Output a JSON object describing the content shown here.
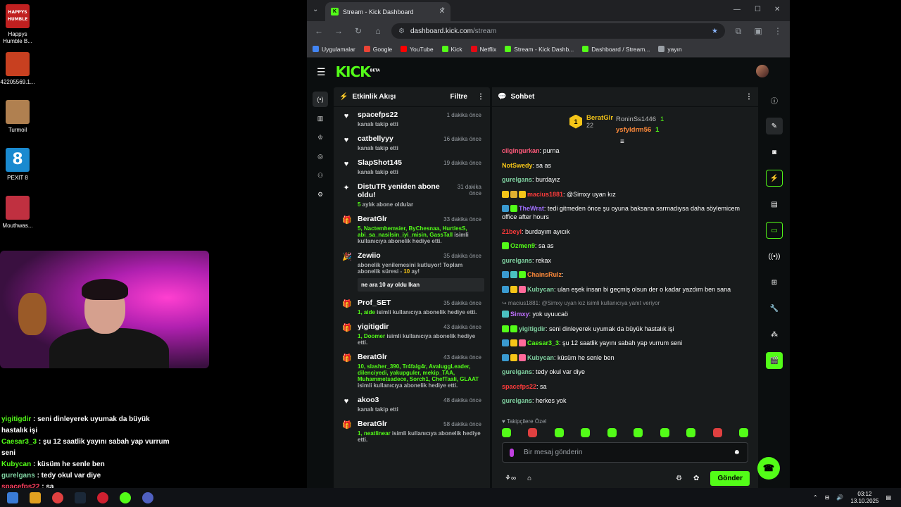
{
  "desktop": {
    "icons": [
      {
        "label": "Happys Humble B...",
        "logo_text": "HAPPYS HUMBLE",
        "color": "#c02020"
      },
      {
        "label": "42205569.1...",
        "logo_text": "",
        "color": "#c84020"
      },
      {
        "label": "Turmoil",
        "logo_text": "",
        "color": "#b08050"
      },
      {
        "label": "PEXIT 8",
        "logo_text": "8",
        "color": "#1a8ad0"
      },
      {
        "label": "Mouthwas...",
        "logo_text": "",
        "color": "#c03040"
      }
    ]
  },
  "overlay_chat": [
    {
      "user": "yigitigdir",
      "text": " : seni dinleyerek uyumak da büyük hastalık işi",
      "color": "green"
    },
    {
      "user": "Caesar3_3",
      "text": " : şu 12 saatlik yayını sabah yap vurrum seni",
      "color": "green"
    },
    {
      "user": "Kubycan",
      "text": " : küsüm he senle ben",
      "color": "green"
    },
    {
      "user": "gurelgans",
      "text": " : tedy okul var diye",
      "color": "teal"
    },
    {
      "user": "spacefps22",
      "text": " : sa",
      "color": "red"
    },
    {
      "user": "gurelgans",
      "text": " : herkes yok",
      "color": "teal"
    }
  ],
  "browser": {
    "tab_title": "Stream - Kick Dashboard",
    "url_host": "dashboard.kick.com",
    "url_path": "/stream",
    "bookmarks": [
      {
        "label": "Uygulamalar",
        "color": "#4285f4"
      },
      {
        "label": "Google",
        "color": "#ea4335"
      },
      {
        "label": "YouTube",
        "color": "#ff0000"
      },
      {
        "label": "Kick",
        "color": "#53fc18"
      },
      {
        "label": "Netflix",
        "color": "#e50914"
      },
      {
        "label": "Stream - Kick Dashb...",
        "color": "#53fc18"
      },
      {
        "label": "Dashboard / Stream...",
        "color": "#53fc18"
      },
      {
        "label": "yayın",
        "color": "#9aa0a6"
      }
    ]
  },
  "kick": {
    "logo": "KICK",
    "logo_sup": "BETA",
    "activity": {
      "title": "Etkinlik Akışı",
      "filter_label": "Filtre",
      "events": [
        {
          "icon": "heart",
          "name": "spacefps22",
          "time": "1 dakika önce",
          "sub": "kanalı takip etti"
        },
        {
          "icon": "heart",
          "name": "catbellyyy",
          "time": "16 dakika önce",
          "sub": "kanalı takip etti"
        },
        {
          "icon": "heart",
          "name": "SlapShot145",
          "time": "19 dakika önce",
          "sub": "kanalı takip etti"
        },
        {
          "icon": "star",
          "name": "DistuTR yeniden abone oldu!",
          "time": "31 dakika önce",
          "sub_highlight": "5",
          "sub": " aylık abone oldular"
        },
        {
          "icon": "gift",
          "name": "BeratGlr",
          "time": "33 dakika önce",
          "sub_highlight": "5, Nactemhemsier, ByChesnaa, HurtlesS, abi_sa_nasilsin_iyi_misin, GassTall",
          "sub": " isimli kullanıcıya abonelik hediye etti."
        },
        {
          "icon": "party",
          "name": "Zewiio",
          "time": "35 dakika önce",
          "sub": "abonelik yenilemesini kutluyor! Toplam abonelik süresi - ",
          "sub_highlight2": "10",
          "sub_end": " ay!",
          "quote": "ne ara 10 ay oldu lkan"
        },
        {
          "icon": "gift",
          "name": "Prof_SET",
          "time": "35 dakika önce",
          "sub_highlight": "1, aide",
          "sub": " isimli kullanıcıya abonelik hediye etti."
        },
        {
          "icon": "gift",
          "name": "yigitigdir",
          "time": "43 dakika önce",
          "sub_highlight": "1, Doomer",
          "sub": " isimli kullanıcıya abonelik hediye etti."
        },
        {
          "icon": "gift-purple",
          "name": "BeratGlr",
          "time": "43 dakika önce",
          "sub_highlight": "10, slasher_390, Tr4falg4r, AvaluggLeader, dilenciyedi, yakupguler, mekip_TAA, Muhammetsadece, Sorch1, ChefTaali, GLAAT",
          "sub": " isimli kullanıcıya abonelik hediye etti."
        },
        {
          "icon": "heart",
          "name": "akoo3",
          "time": "48 dakika önce",
          "sub": "kanalı takip etti"
        },
        {
          "icon": "gift",
          "name": "BeratGlr",
          "time": "58 dakika önce",
          "sub_highlight": "1, neatlinear",
          "sub": " isimli kullanıcıya abonelik hediye etti."
        }
      ]
    },
    "chat": {
      "title": "Sohbet",
      "leader": {
        "rank": "1",
        "name": "BeratGlr",
        "count": "22"
      },
      "leaders_right": [
        {
          "name": "RoninSs1446",
          "count": "1"
        },
        {
          "name": "ysfyldrm56",
          "count": "1"
        }
      ],
      "messages": [
        {
          "user": "cilgingurkan",
          "color": "#ff5a7a",
          "badges": [],
          "text": ": purna"
        },
        {
          "user": "NotSwedy",
          "color": "#f5c518",
          "badges": [],
          "text": ": sa as"
        },
        {
          "user": "gurelgans",
          "color": "#7fd0a0",
          "badges": [],
          "text": ": burdayız"
        },
        {
          "user": "macius1881",
          "color": "#ff3b3b",
          "badges": [
            "#f5c518",
            "#e0b030",
            "#f5c518"
          ],
          "text": ": @Simxy uyan kız"
        },
        {
          "user": "TheWrat",
          "color": "#a070ff",
          "badges": [
            "#3a9ad0",
            "#53fc18"
          ],
          "text": ": tedi gitmeden önce şu oyuna baksana sarmadıysa daha söylemicem office after hours"
        },
        {
          "user": "21beyl",
          "color": "#ff3b3b",
          "badges": [],
          "text": ": burdayım ayıcık"
        },
        {
          "user": "Ozmen9",
          "color": "#53fc18",
          "badges": [
            "#53fc18"
          ],
          "text": ": sa as"
        },
        {
          "user": "gurelgans",
          "color": "#7fd0a0",
          "badges": [],
          "text": ": rekax"
        },
        {
          "user": "ChainsRulz",
          "color": "#ff8a3a",
          "badges": [
            "#3a9ad0",
            "#4ac0c0",
            "#53fc18"
          ],
          "text": ":"
        },
        {
          "user": "Kubycan",
          "color": "#7fd0a0",
          "badges": [
            "#3a9ad0",
            "#f5c518",
            "#ff6a9a"
          ],
          "text": ": ulan eşek insan bi geçmiş olsun der o kadar yazdım ben sana"
        },
        {
          "reply": "macius1881: @Simxy uyan kız isimli kullanıcıya yanıt veriyor",
          "user": "Simxy",
          "color": "#c070ff",
          "badges": [
            "#4ac0c0"
          ],
          "text": ": yok uyuucaö"
        },
        {
          "user": "yigitigdir",
          "color": "#7fd0a0",
          "badges": [
            "#53fc18",
            "#53fc18"
          ],
          "text": ": seni dinleyerek uyumak da büyük hastalık işi"
        },
        {
          "user": "Caesar3_3",
          "color": "#53fc18",
          "badges": [
            "#3a9ad0",
            "#f5c518",
            "#ff6a9a"
          ],
          "text": ": şu 12 saatlik yayını sabah yap vurrum seni"
        },
        {
          "user": "Kubycan",
          "color": "#7fd0a0",
          "badges": [
            "#3a9ad0",
            "#f5c518",
            "#ff6a9a"
          ],
          "text": ": küsüm he senle ben"
        },
        {
          "user": "gurelgans",
          "color": "#7fd0a0",
          "badges": [],
          "text": ": tedy okul var diye"
        },
        {
          "user": "spacefps22",
          "color": "#ff3b3b",
          "badges": [],
          "text": ": sa"
        },
        {
          "user": "gurelgans",
          "color": "#7fd0a0",
          "badges": [],
          "text": ": herkes yok"
        }
      ],
      "emote_label": "Takipçilere Özel",
      "input_placeholder": "Bir mesaj gönderin",
      "send_label": "Gönder"
    }
  },
  "taskbar": {
    "time": "03:12",
    "date": "13.10.2025"
  }
}
